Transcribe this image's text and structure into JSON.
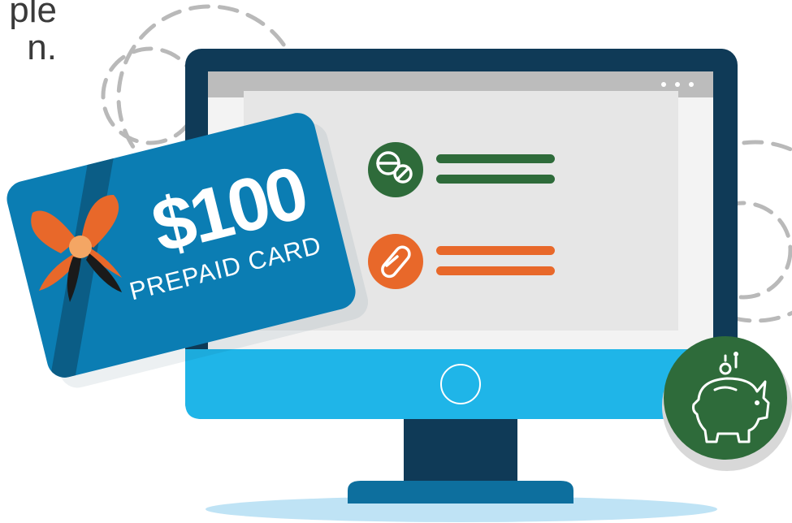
{
  "heading_fragment": "ple\nn.",
  "card": {
    "amount": "$100",
    "label": "PREPAID CARD"
  },
  "browser": {
    "menu_dots": "• • •"
  },
  "list_items": [
    {
      "icon": "pills-icon",
      "color": "#2e6b3a"
    },
    {
      "icon": "capsule-icon",
      "color": "#e8682a"
    }
  ],
  "colors": {
    "monitor_frame": "#0f3a57",
    "monitor_chin": "#1fb5e8",
    "card_blue": "#0b7db3",
    "ribbon_orange": "#e8682a",
    "accent_green": "#2e6b3a",
    "accent_orange": "#e8682a",
    "stand": "#0d6f9e",
    "floor_shadow": "#bfe3f5"
  },
  "icons": {
    "piggy_bank": "piggy-bank-icon",
    "ribbon": "ribbon-bow-icon"
  }
}
